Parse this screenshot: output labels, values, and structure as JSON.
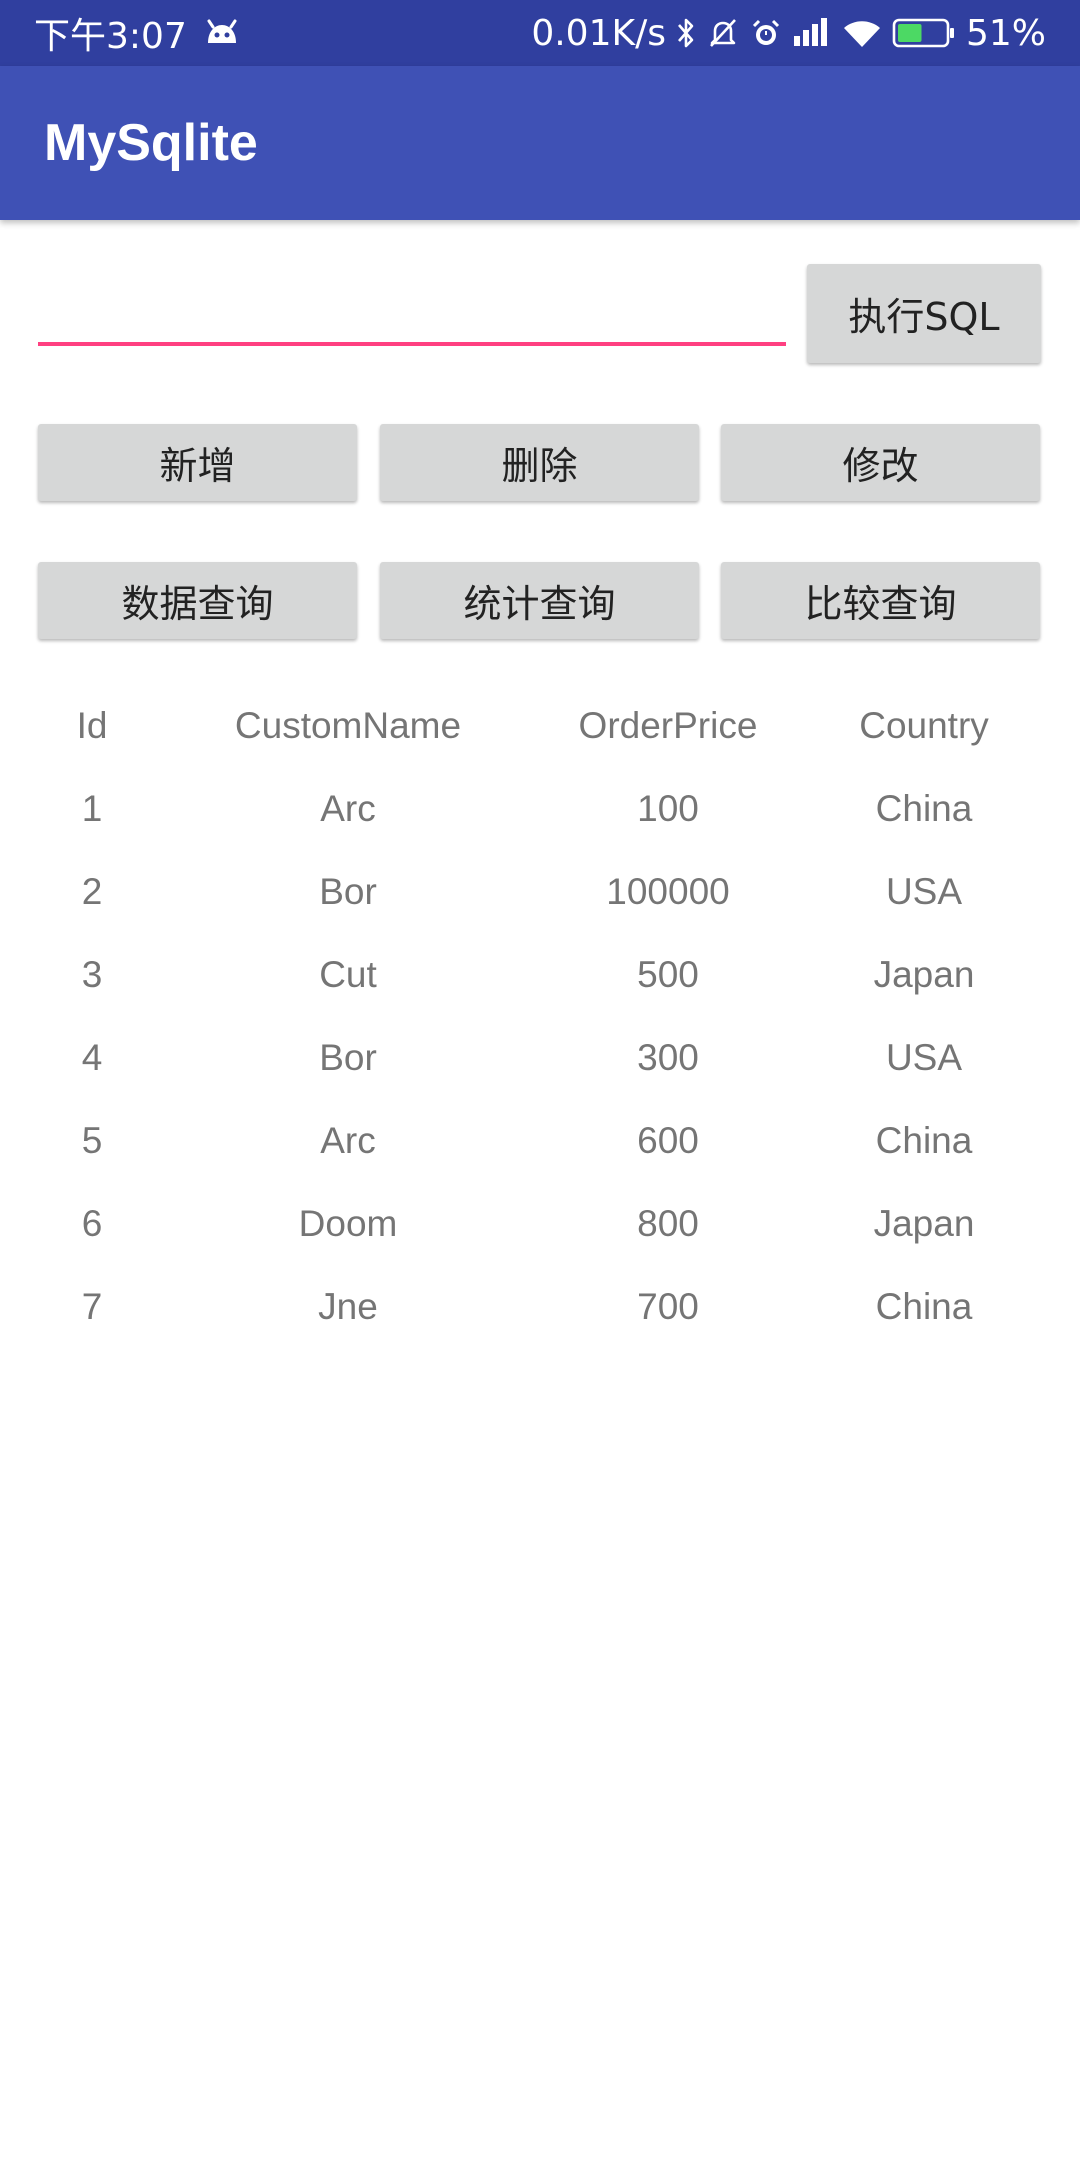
{
  "status_bar": {
    "time": "下午3:07",
    "network_speed": "0.01K/s",
    "battery_percent": "51%",
    "battery_level": 0.51,
    "icons": [
      "android-icon",
      "bluetooth-icon",
      "mute-bell-icon",
      "alarm-icon",
      "signal-icon",
      "wifi-icon",
      "battery-icon"
    ]
  },
  "app_bar": {
    "title": "MySqlite"
  },
  "sql_input": {
    "value": "",
    "placeholder": ""
  },
  "buttons": {
    "execute_sql": "执行SQL",
    "add": "新增",
    "delete": "删除",
    "modify": "修改",
    "data_query": "数据查询",
    "stat_query": "统计查询",
    "compare_query": "比较查询"
  },
  "table": {
    "headers": [
      "Id",
      "CustomName",
      "OrderPrice",
      "Country"
    ],
    "rows": [
      [
        "1",
        "Arc",
        "100",
        "China"
      ],
      [
        "2",
        "Bor",
        "100000",
        "USA"
      ],
      [
        "3",
        "Cut",
        "500",
        "Japan"
      ],
      [
        "4",
        "Bor",
        "300",
        "USA"
      ],
      [
        "5",
        "Arc",
        "600",
        "China"
      ],
      [
        "6",
        "Doom",
        "800",
        "Japan"
      ],
      [
        "7",
        "Jne",
        "700",
        "China"
      ]
    ]
  },
  "colors": {
    "status_bar": "#303F9F",
    "app_bar": "#3F51B5",
    "accent": "#FF4081",
    "button": "#D6D7D7",
    "table_text": "#757575",
    "battery_fill": "#4CD964"
  }
}
